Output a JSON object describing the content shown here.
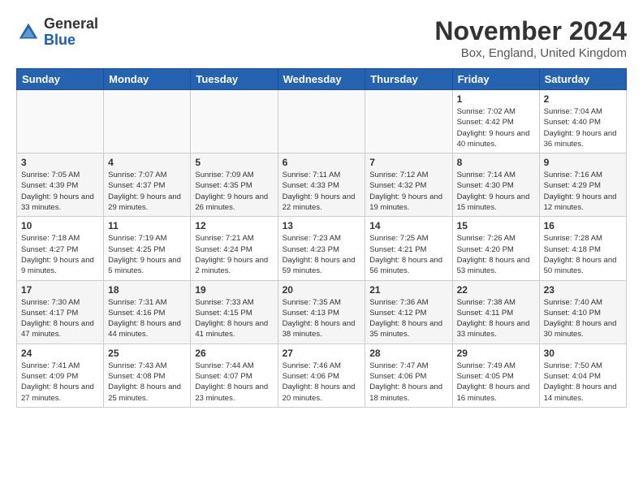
{
  "header": {
    "logo_general": "General",
    "logo_blue": "Blue",
    "month_title": "November 2024",
    "location": "Box, England, United Kingdom"
  },
  "days_of_week": [
    "Sunday",
    "Monday",
    "Tuesday",
    "Wednesday",
    "Thursday",
    "Friday",
    "Saturday"
  ],
  "weeks": [
    [
      {
        "day": "",
        "info": ""
      },
      {
        "day": "",
        "info": ""
      },
      {
        "day": "",
        "info": ""
      },
      {
        "day": "",
        "info": ""
      },
      {
        "day": "",
        "info": ""
      },
      {
        "day": "1",
        "info": "Sunrise: 7:02 AM\nSunset: 4:42 PM\nDaylight: 9 hours and 40 minutes."
      },
      {
        "day": "2",
        "info": "Sunrise: 7:04 AM\nSunset: 4:40 PM\nDaylight: 9 hours and 36 minutes."
      }
    ],
    [
      {
        "day": "3",
        "info": "Sunrise: 7:05 AM\nSunset: 4:39 PM\nDaylight: 9 hours and 33 minutes."
      },
      {
        "day": "4",
        "info": "Sunrise: 7:07 AM\nSunset: 4:37 PM\nDaylight: 9 hours and 29 minutes."
      },
      {
        "day": "5",
        "info": "Sunrise: 7:09 AM\nSunset: 4:35 PM\nDaylight: 9 hours and 26 minutes."
      },
      {
        "day": "6",
        "info": "Sunrise: 7:11 AM\nSunset: 4:33 PM\nDaylight: 9 hours and 22 minutes."
      },
      {
        "day": "7",
        "info": "Sunrise: 7:12 AM\nSunset: 4:32 PM\nDaylight: 9 hours and 19 minutes."
      },
      {
        "day": "8",
        "info": "Sunrise: 7:14 AM\nSunset: 4:30 PM\nDaylight: 9 hours and 15 minutes."
      },
      {
        "day": "9",
        "info": "Sunrise: 7:16 AM\nSunset: 4:29 PM\nDaylight: 9 hours and 12 minutes."
      }
    ],
    [
      {
        "day": "10",
        "info": "Sunrise: 7:18 AM\nSunset: 4:27 PM\nDaylight: 9 hours and 9 minutes."
      },
      {
        "day": "11",
        "info": "Sunrise: 7:19 AM\nSunset: 4:25 PM\nDaylight: 9 hours and 5 minutes."
      },
      {
        "day": "12",
        "info": "Sunrise: 7:21 AM\nSunset: 4:24 PM\nDaylight: 9 hours and 2 minutes."
      },
      {
        "day": "13",
        "info": "Sunrise: 7:23 AM\nSunset: 4:23 PM\nDaylight: 8 hours and 59 minutes."
      },
      {
        "day": "14",
        "info": "Sunrise: 7:25 AM\nSunset: 4:21 PM\nDaylight: 8 hours and 56 minutes."
      },
      {
        "day": "15",
        "info": "Sunrise: 7:26 AM\nSunset: 4:20 PM\nDaylight: 8 hours and 53 minutes."
      },
      {
        "day": "16",
        "info": "Sunrise: 7:28 AM\nSunset: 4:18 PM\nDaylight: 8 hours and 50 minutes."
      }
    ],
    [
      {
        "day": "17",
        "info": "Sunrise: 7:30 AM\nSunset: 4:17 PM\nDaylight: 8 hours and 47 minutes."
      },
      {
        "day": "18",
        "info": "Sunrise: 7:31 AM\nSunset: 4:16 PM\nDaylight: 8 hours and 44 minutes."
      },
      {
        "day": "19",
        "info": "Sunrise: 7:33 AM\nSunset: 4:15 PM\nDaylight: 8 hours and 41 minutes."
      },
      {
        "day": "20",
        "info": "Sunrise: 7:35 AM\nSunset: 4:13 PM\nDaylight: 8 hours and 38 minutes."
      },
      {
        "day": "21",
        "info": "Sunrise: 7:36 AM\nSunset: 4:12 PM\nDaylight: 8 hours and 35 minutes."
      },
      {
        "day": "22",
        "info": "Sunrise: 7:38 AM\nSunset: 4:11 PM\nDaylight: 8 hours and 33 minutes."
      },
      {
        "day": "23",
        "info": "Sunrise: 7:40 AM\nSunset: 4:10 PM\nDaylight: 8 hours and 30 minutes."
      }
    ],
    [
      {
        "day": "24",
        "info": "Sunrise: 7:41 AM\nSunset: 4:09 PM\nDaylight: 8 hours and 27 minutes."
      },
      {
        "day": "25",
        "info": "Sunrise: 7:43 AM\nSunset: 4:08 PM\nDaylight: 8 hours and 25 minutes."
      },
      {
        "day": "26",
        "info": "Sunrise: 7:44 AM\nSunset: 4:07 PM\nDaylight: 8 hours and 23 minutes."
      },
      {
        "day": "27",
        "info": "Sunrise: 7:46 AM\nSunset: 4:06 PM\nDaylight: 8 hours and 20 minutes."
      },
      {
        "day": "28",
        "info": "Sunrise: 7:47 AM\nSunset: 4:06 PM\nDaylight: 8 hours and 18 minutes."
      },
      {
        "day": "29",
        "info": "Sunrise: 7:49 AM\nSunset: 4:05 PM\nDaylight: 8 hours and 16 minutes."
      },
      {
        "day": "30",
        "info": "Sunrise: 7:50 AM\nSunset: 4:04 PM\nDaylight: 8 hours and 14 minutes."
      }
    ]
  ]
}
